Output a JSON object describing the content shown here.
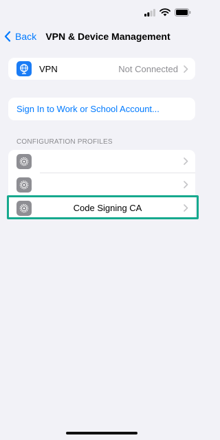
{
  "nav": {
    "back_label": "Back",
    "title": "VPN & Device Management"
  },
  "vpn": {
    "label": "VPN",
    "status": "Not Connected"
  },
  "signin": {
    "label": "Sign In to Work or School Account..."
  },
  "profiles": {
    "header": "CONFIGURATION PROFILES",
    "items": [
      {
        "name": ""
      },
      {
        "name": ""
      },
      {
        "name": "Code Signing CA"
      }
    ]
  },
  "colors": {
    "accent": "#007aff",
    "highlight": "#16a98e",
    "vpn_icon": "#1a7cf5",
    "gear_icon": "#8e8e93"
  }
}
